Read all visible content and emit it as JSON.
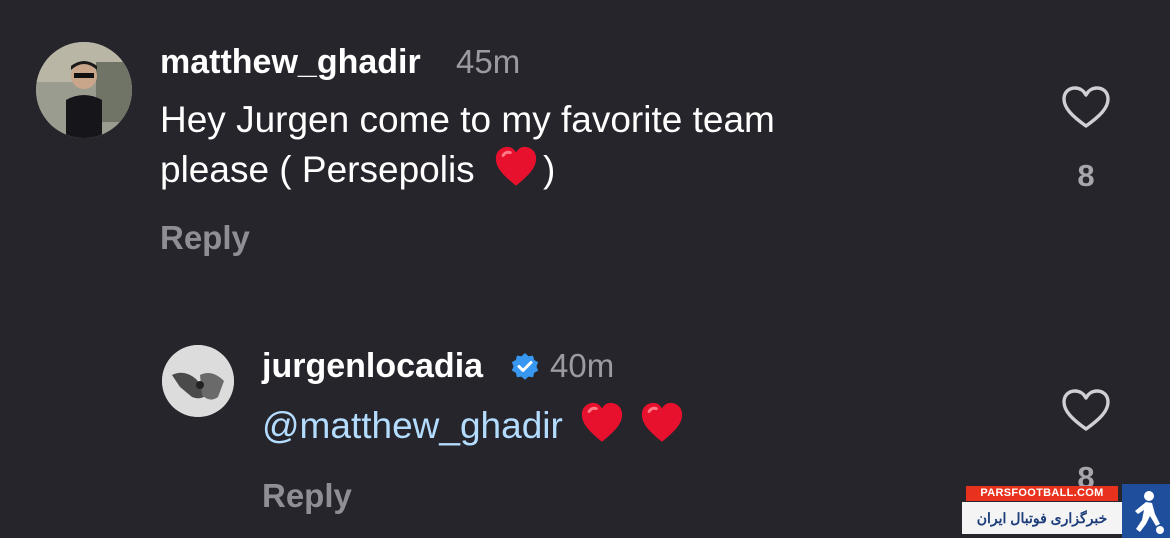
{
  "comments": [
    {
      "username": "matthew_ghadir",
      "time": "45m",
      "text_line1": "Hey Jurgen come to my favorite team",
      "text_line2": "please ( Persepolis ",
      "text_line2_end": ")",
      "reply_label": "Reply",
      "likes": "8"
    },
    {
      "username": "jurgenlocadia",
      "verified": true,
      "time": "40m",
      "mention": "@matthew_ghadir",
      "reply_label": "Reply",
      "likes": "8"
    }
  ],
  "watermark": {
    "top_text": "PARSFOOTBALL.COM",
    "bottom_text": "خبرگزاری فوتبال ایران"
  },
  "colors": {
    "background": "#25252b",
    "mention": "#b3dcff",
    "verified": "#3897f0",
    "emoji_heart": "#e8112d"
  },
  "icons": [
    "heart-outline-icon",
    "verified-badge-icon",
    "red-heart-emoji"
  ]
}
